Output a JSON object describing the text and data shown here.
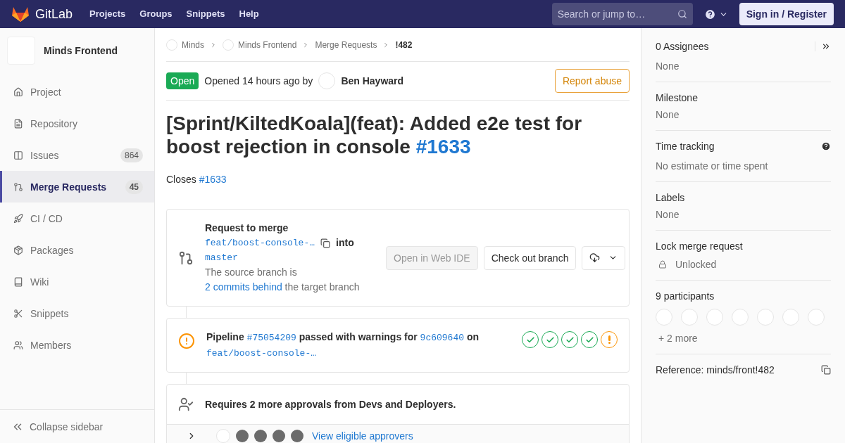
{
  "navbar": {
    "brand": "GitLab",
    "links": [
      "Projects",
      "Groups",
      "Snippets",
      "Help"
    ],
    "search": {
      "placeholder": "Search or jump to…"
    },
    "sign_in": "Sign in / Register"
  },
  "sidebar": {
    "project": "Minds Frontend",
    "items": [
      {
        "label": "Project",
        "selected": false
      },
      {
        "label": "Repository",
        "selected": false
      },
      {
        "label": "Issues",
        "count": "864",
        "selected": false
      },
      {
        "label": "Merge Requests",
        "count": "45",
        "selected": true
      },
      {
        "label": "CI / CD",
        "selected": false
      },
      {
        "label": "Packages",
        "selected": false
      },
      {
        "label": "Wiki",
        "selected": false
      },
      {
        "label": "Snippets",
        "selected": false
      },
      {
        "label": "Members",
        "selected": false
      }
    ],
    "collapse": "Collapse sidebar"
  },
  "breadcrumbs": [
    "Minds",
    "Minds Frontend",
    "Merge Requests",
    "!482"
  ],
  "header": {
    "status": "Open",
    "opened": "Opened 14 hours ago by",
    "author": "Ben Hayward",
    "report": "Report abuse"
  },
  "title": {
    "text": "[Sprint/KiltedKoala](feat): Added e2e test for boost rejection in console",
    "ref": "#1633"
  },
  "description": {
    "text": "Closes",
    "ref": "#1633"
  },
  "merge_widget": {
    "heading": "Request to merge",
    "source": "feat/boost-console-…",
    "into": "into",
    "target": "master",
    "behind_pre": "The source branch is",
    "behind_link": "2 commits behind",
    "behind_post": "the target branch",
    "web_ide": "Open in Web IDE",
    "checkout": "Check out branch"
  },
  "pipeline": {
    "label": "Pipeline",
    "id": "#75054209",
    "status_text": "passed with warnings for",
    "commit": "9c609640",
    "on": "on",
    "branch": "feat/boost-console-…",
    "stages": [
      {
        "kind": "success"
      },
      {
        "kind": "success"
      },
      {
        "kind": "success"
      },
      {
        "kind": "success"
      },
      {
        "kind": "warning"
      }
    ]
  },
  "approvals": {
    "text": "Requires 2 more approvals from Devs and Deployers.",
    "link": "View eligible approvers"
  },
  "right_sidebar": {
    "assignees": {
      "title": "0 Assignees",
      "value": "None"
    },
    "milestone": {
      "title": "Milestone",
      "value": "None"
    },
    "time_tracking": {
      "title": "Time tracking",
      "value": "No estimate or time spent"
    },
    "labels": {
      "title": "Labels",
      "value": "None"
    },
    "lock": {
      "title": "Lock merge request",
      "value": "Unlocked"
    },
    "participants": {
      "title": "9 participants",
      "more": "+ 2 more"
    },
    "reference": "Reference: minds/front!482"
  }
}
